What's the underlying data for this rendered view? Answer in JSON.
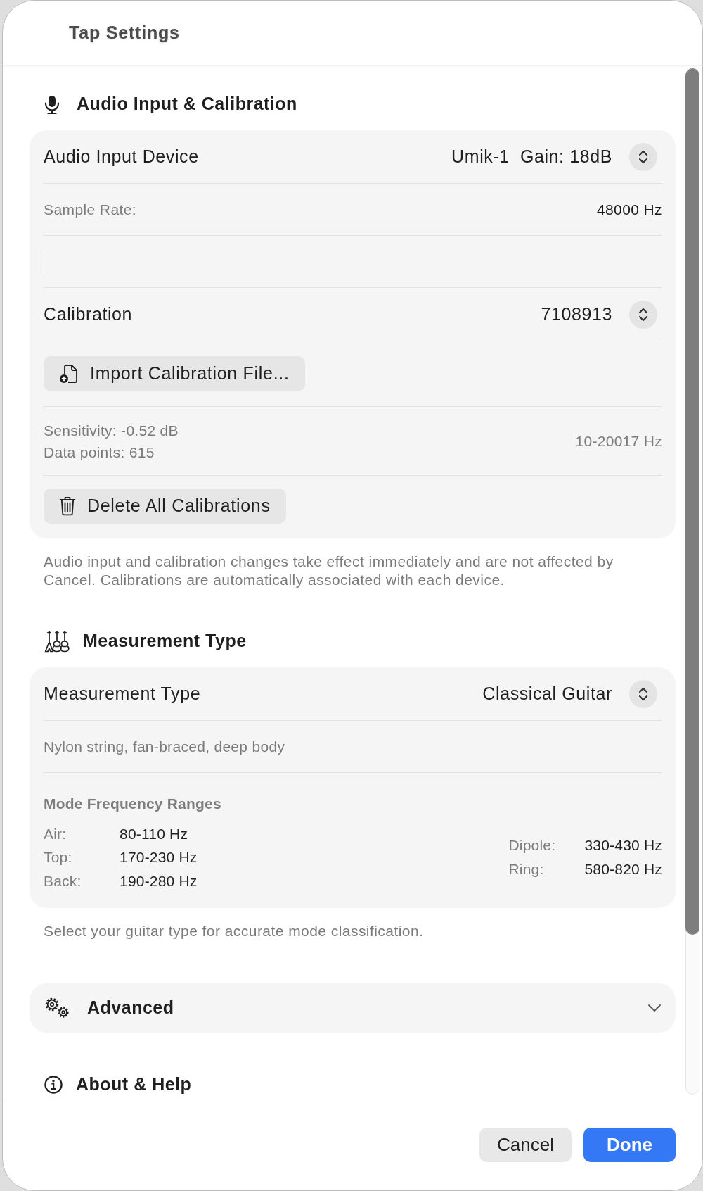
{
  "window": {
    "title": "Tap Settings"
  },
  "sections": [
    {
      "kind": "group",
      "title": "Audio Input & Calibration",
      "rows": [
        {
          "kind": "picker",
          "label": "Audio Input Device",
          "value": "Umik-1  Gain: 18dB"
        },
        {
          "kind": "info",
          "label": "Sample Rate:",
          "value": "48000 Hz"
        },
        {
          "kind": "blank"
        },
        {
          "kind": "picker",
          "label": "Calibration",
          "value": "7108913"
        },
        {
          "kind": "action",
          "label": "Import Calibration File..."
        },
        {
          "kind": "details",
          "lines": [
            "Sensitivity: -0.52 dB",
            "Data points: 615"
          ],
          "aside": "10-20017 Hz"
        },
        {
          "kind": "action",
          "label": "Delete All Calibrations"
        }
      ],
      "footer": "Audio input and calibration changes take effect immediately and are not affected by Cancel. Calibrations are automatically associated with each device."
    },
    {
      "kind": "group",
      "title": "Measurement Type",
      "rows": [
        {
          "kind": "picker",
          "label": "Measurement Type",
          "value": "Classical Guitar"
        },
        {
          "kind": "note",
          "text": "Nylon string, fan-braced, deep body"
        },
        {
          "kind": "ranges",
          "title": "Mode Frequency Ranges",
          "left": [
            {
              "label": "Air:",
              "value": "80-110 Hz"
            },
            {
              "label": "Top:",
              "value": "170-230 Hz"
            },
            {
              "label": "Back:",
              "value": "190-280 Hz"
            }
          ],
          "right": [
            {
              "label": "Dipole:",
              "value": "330-430 Hz"
            },
            {
              "label": "Ring:",
              "value": "580-820 Hz"
            }
          ]
        }
      ],
      "footer": "Select your guitar type for accurate mode classification."
    },
    {
      "kind": "disclosure",
      "title": "Advanced",
      "expanded": false
    },
    {
      "kind": "heading",
      "title": "About & Help"
    }
  ],
  "buttons": [
    {
      "label": "Cancel",
      "kind": "plain"
    },
    {
      "label": "Done",
      "kind": "default"
    }
  ]
}
